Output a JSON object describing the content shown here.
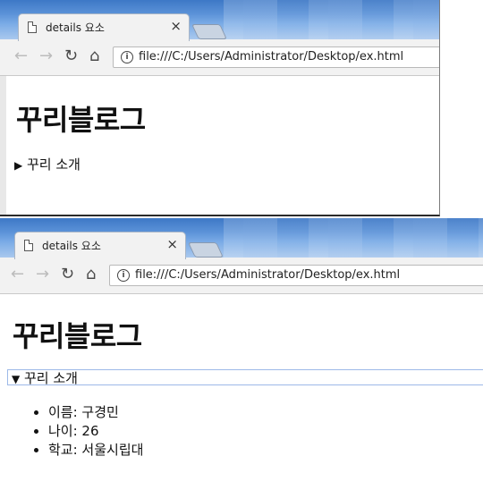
{
  "browser": {
    "tab_title": "details 요소",
    "tab_close": "×",
    "url": "file:///C:/Users/Administrator/Desktop/ex.html"
  },
  "page": {
    "heading": "꾸리블로그",
    "summary_label": "꾸리 소개",
    "collapsed_marker": "▶",
    "expanded_marker": "▼",
    "details_items": [
      "이름: 구경민",
      "나이: 26",
      "학교: 서울시립대"
    ]
  },
  "icons": {
    "back": "back-arrow-icon",
    "forward": "forward-arrow-icon",
    "reload": "reload-icon",
    "home": "home-icon",
    "info": "info-icon",
    "page": "page-icon"
  },
  "colors": {
    "titlebar": "#5b92d8",
    "toolbar": "#f2f2f2",
    "focus_outline": "#9db9e8"
  }
}
